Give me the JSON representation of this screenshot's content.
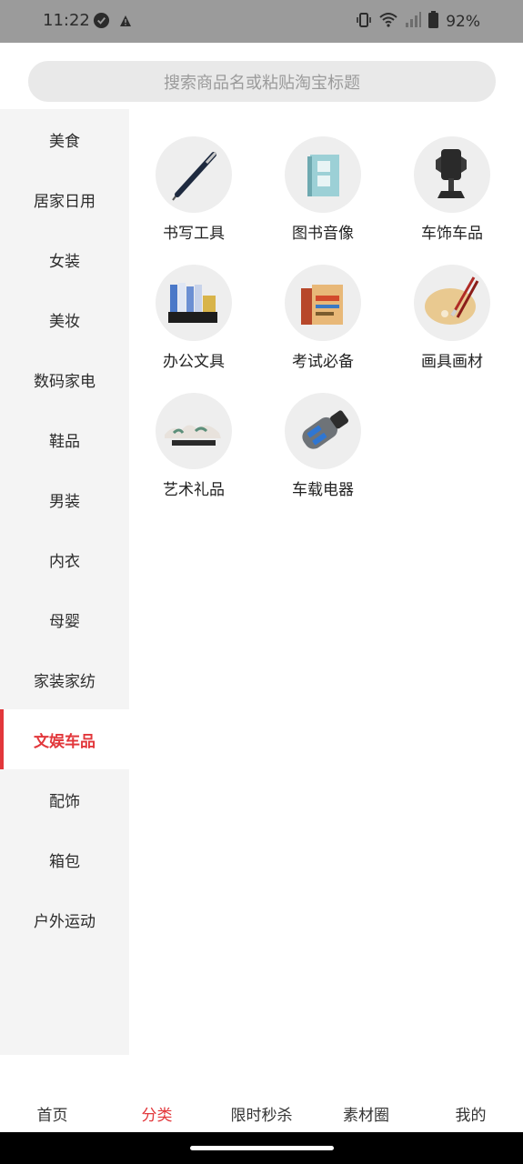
{
  "status_bar": {
    "time": "11:22",
    "battery": "92%"
  },
  "search": {
    "placeholder": "搜索商品名或粘贴淘宝标题"
  },
  "sidebar": {
    "items": [
      {
        "label": "美食"
      },
      {
        "label": "居家日用"
      },
      {
        "label": "女装"
      },
      {
        "label": "美妆"
      },
      {
        "label": "数码家电"
      },
      {
        "label": "鞋品"
      },
      {
        "label": "男装"
      },
      {
        "label": "内衣"
      },
      {
        "label": "母婴"
      },
      {
        "label": "家装家纺"
      },
      {
        "label": "文娱车品",
        "active": true
      },
      {
        "label": "配饰"
      },
      {
        "label": "箱包"
      },
      {
        "label": "户外运动"
      }
    ]
  },
  "categories": [
    {
      "label": "书写工具",
      "icon": "pen-icon"
    },
    {
      "label": "图书音像",
      "icon": "book-icon"
    },
    {
      "label": "车饰车品",
      "icon": "phone-holder-icon"
    },
    {
      "label": "办公文具",
      "icon": "file-organizer-icon"
    },
    {
      "label": "考试必备",
      "icon": "exam-books-icon"
    },
    {
      "label": "画具画材",
      "icon": "palette-icon"
    },
    {
      "label": "艺术礼品",
      "icon": "art-gift-icon"
    },
    {
      "label": "车载电器",
      "icon": "car-charger-icon"
    }
  ],
  "bottom_nav": {
    "items": [
      {
        "label": "首页"
      },
      {
        "label": "分类",
        "active": true
      },
      {
        "label": "限时秒杀"
      },
      {
        "label": "素材圈"
      },
      {
        "label": "我的"
      }
    ]
  },
  "colors": {
    "accent": "#e2373b",
    "sidebar_bg": "#f4f4f4",
    "status_bar_bg": "#9b9b9b"
  }
}
